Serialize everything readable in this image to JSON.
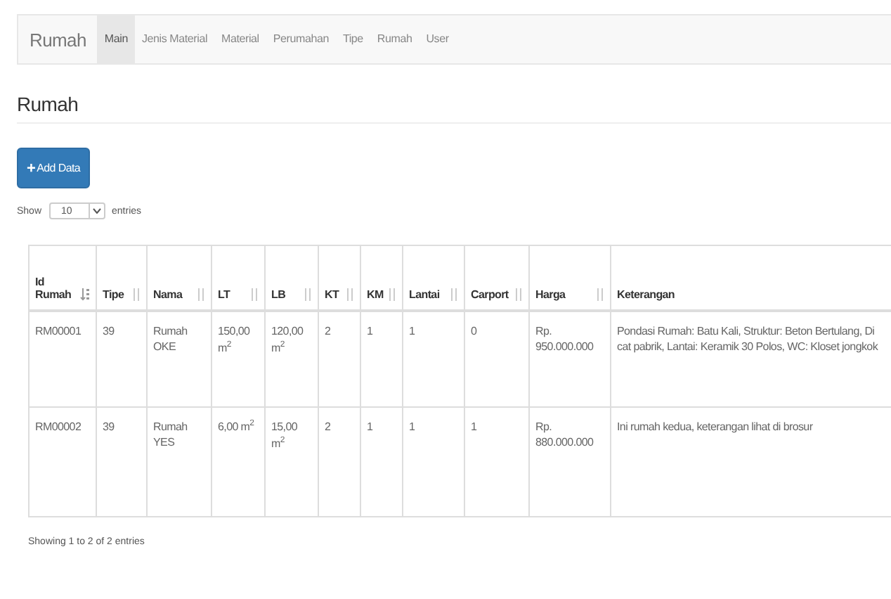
{
  "navbar": {
    "brand": "Rumah",
    "items": [
      {
        "label": "Main",
        "selected": true
      },
      {
        "label": "Jenis Material",
        "selected": false
      },
      {
        "label": "Material",
        "selected": false
      },
      {
        "label": "Perumahan",
        "selected": false
      },
      {
        "label": "Tipe",
        "selected": false
      },
      {
        "label": "Rumah",
        "selected": false
      },
      {
        "label": "User",
        "selected": false
      }
    ]
  },
  "heading": "Rumah",
  "add_button": {
    "icon": "+",
    "label": "Add Data"
  },
  "length_control": {
    "prefix": "Show",
    "value": "10",
    "suffix": "entries"
  },
  "table": {
    "columns": [
      {
        "label": "Id Rumah",
        "sortable": true,
        "sorted": true
      },
      {
        "label": "Tipe",
        "sortable": true,
        "sorted": false
      },
      {
        "label": "Nama",
        "sortable": true,
        "sorted": false
      },
      {
        "label": "LT",
        "sortable": true,
        "sorted": false
      },
      {
        "label": "LB",
        "sortable": true,
        "sorted": false
      },
      {
        "label": "KT",
        "sortable": true,
        "sorted": false
      },
      {
        "label": "KM",
        "sortable": true,
        "sorted": false
      },
      {
        "label": "Lantai",
        "sortable": true,
        "sorted": false
      },
      {
        "label": "Carport",
        "sortable": true,
        "sorted": false
      },
      {
        "label": "Harga",
        "sortable": true,
        "sorted": false
      },
      {
        "label": "Keterangan"
      }
    ],
    "rows": [
      {
        "cells": [
          "RM00001",
          "39",
          "Rumah OKE",
          "150,00 m$^{2}$",
          "120,00 m$^{2}$",
          "2",
          "1",
          "1",
          "0",
          "Rp. 950.000.000"
        ],
        "keterangan": [
          "Pondasi Rumah: Batu Kali, Struktur: Beton Bertulang, Di",
          "cat pabrik, Lantai: Keramik 30 Polos, WC: Kloset jongkok"
        ]
      },
      {
        "cells": [
          "RM00002",
          "39",
          "Rumah YES",
          "6,00 m$^{2}$",
          "15,00 m$^{2}$",
          "2",
          "1",
          "1",
          "1",
          "Rp. 880.000.000"
        ],
        "keterangan": [
          "Ini rumah kedua, keterangan lihat di brosur"
        ]
      }
    ]
  },
  "info": "Showing 1 to 2 of 2 entries"
}
